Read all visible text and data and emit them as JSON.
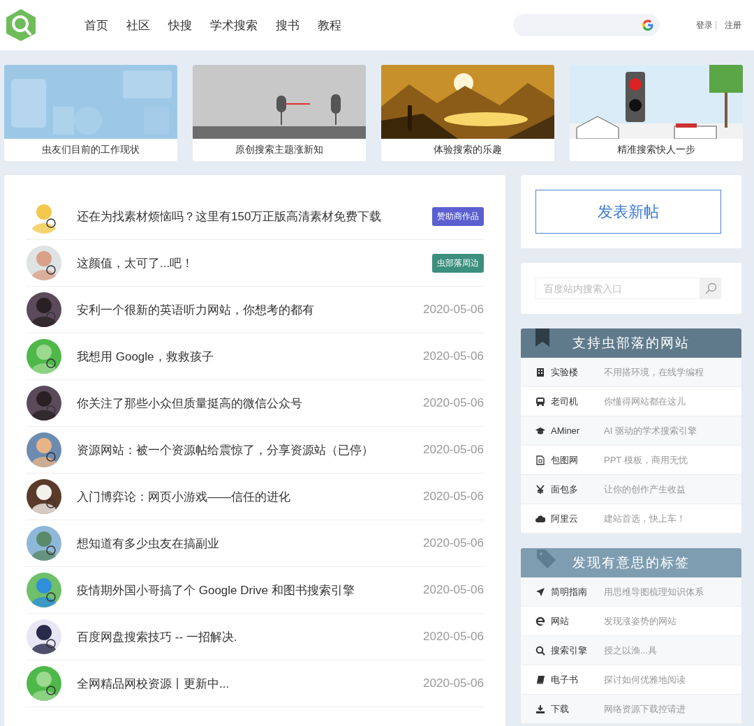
{
  "header": {
    "nav": [
      "首页",
      "社区",
      "快搜",
      "学术搜索",
      "搜书",
      "教程"
    ],
    "auth_links": [
      "登录",
      "注册"
    ]
  },
  "banners": [
    {
      "caption": "虫友们目前的工作现状"
    },
    {
      "caption": "原创搜索主题涨新知"
    },
    {
      "caption": "体验搜索的乐趣"
    },
    {
      "caption": "精准搜索快人一步"
    }
  ],
  "posts": [
    {
      "title": "还在为找素材烦恼吗？这里有150万正版高清素材免费下载",
      "kind": "badge",
      "badge": "赞助商作品",
      "color": "#5b5fcf"
    },
    {
      "title": "这颜值，太可了...吧！",
      "kind": "badge",
      "badge": "虫部落周边",
      "color": "#3b8f7e"
    },
    {
      "title": "安利一个很新的英语听力网站，你想考的都有",
      "kind": "date",
      "date": "2020-05-06"
    },
    {
      "title": "我想用 Google，救救孩子",
      "kind": "date",
      "date": "2020-05-06"
    },
    {
      "title": "你关注了那些小众但质量挺高的微信公众号",
      "kind": "date",
      "date": "2020-05-06"
    },
    {
      "title": "资源网站：被一个资源帖给震惊了，分享资源站（已停）",
      "kind": "date",
      "date": "2020-05-06"
    },
    {
      "title": "入门博弈论：网页小游戏——信任的进化",
      "kind": "date",
      "date": "2020-05-06"
    },
    {
      "title": "想知道有多少虫友在搞副业",
      "kind": "date",
      "date": "2020-05-06"
    },
    {
      "title": "疫情期外国小哥搞了个 Google Drive 和图书搜索引擎",
      "kind": "date",
      "date": "2020-05-06"
    },
    {
      "title": "百度网盘搜索技巧 -- 一招解决.",
      "kind": "date",
      "date": "2020-05-06"
    },
    {
      "title": "全网精品网校资源丨更新中...",
      "kind": "date",
      "date": "2020-05-06"
    }
  ],
  "sidebar": {
    "new_post_button": "发表新帖",
    "site_search": {
      "placeholder": "百度站内搜索入口"
    },
    "panels": [
      {
        "title": "支持虫部落的网站",
        "color": "#5f7a8b",
        "items": [
          {
            "name": "实验楼",
            "description": "不用搭环境，在线学编程"
          },
          {
            "name": "老司机",
            "description": "你懂得网站都在这儿"
          },
          {
            "name": "AMiner",
            "description": "AI 驱动的学术搜索引擎"
          },
          {
            "name": "包图网",
            "description": "PPT 模板，商用无忧"
          },
          {
            "name": "面包多",
            "description": "让你的创作产生收益"
          },
          {
            "name": "阿里云",
            "description": "建站首选，快上车！"
          }
        ]
      },
      {
        "title": "发现有意思的标签",
        "color": "#7f9db1",
        "items": [
          {
            "name": "简明指南",
            "description": "用思维导图梳理知识体系"
          },
          {
            "name": "网站",
            "description": "发现涨姿势的网站"
          },
          {
            "name": "搜索引擎",
            "description": "授之以渔...具"
          },
          {
            "name": "电子书",
            "description": "探讨如何优雅地阅读"
          },
          {
            "name": "下载",
            "description": "网络资源下载控请进"
          }
        ]
      }
    ]
  }
}
